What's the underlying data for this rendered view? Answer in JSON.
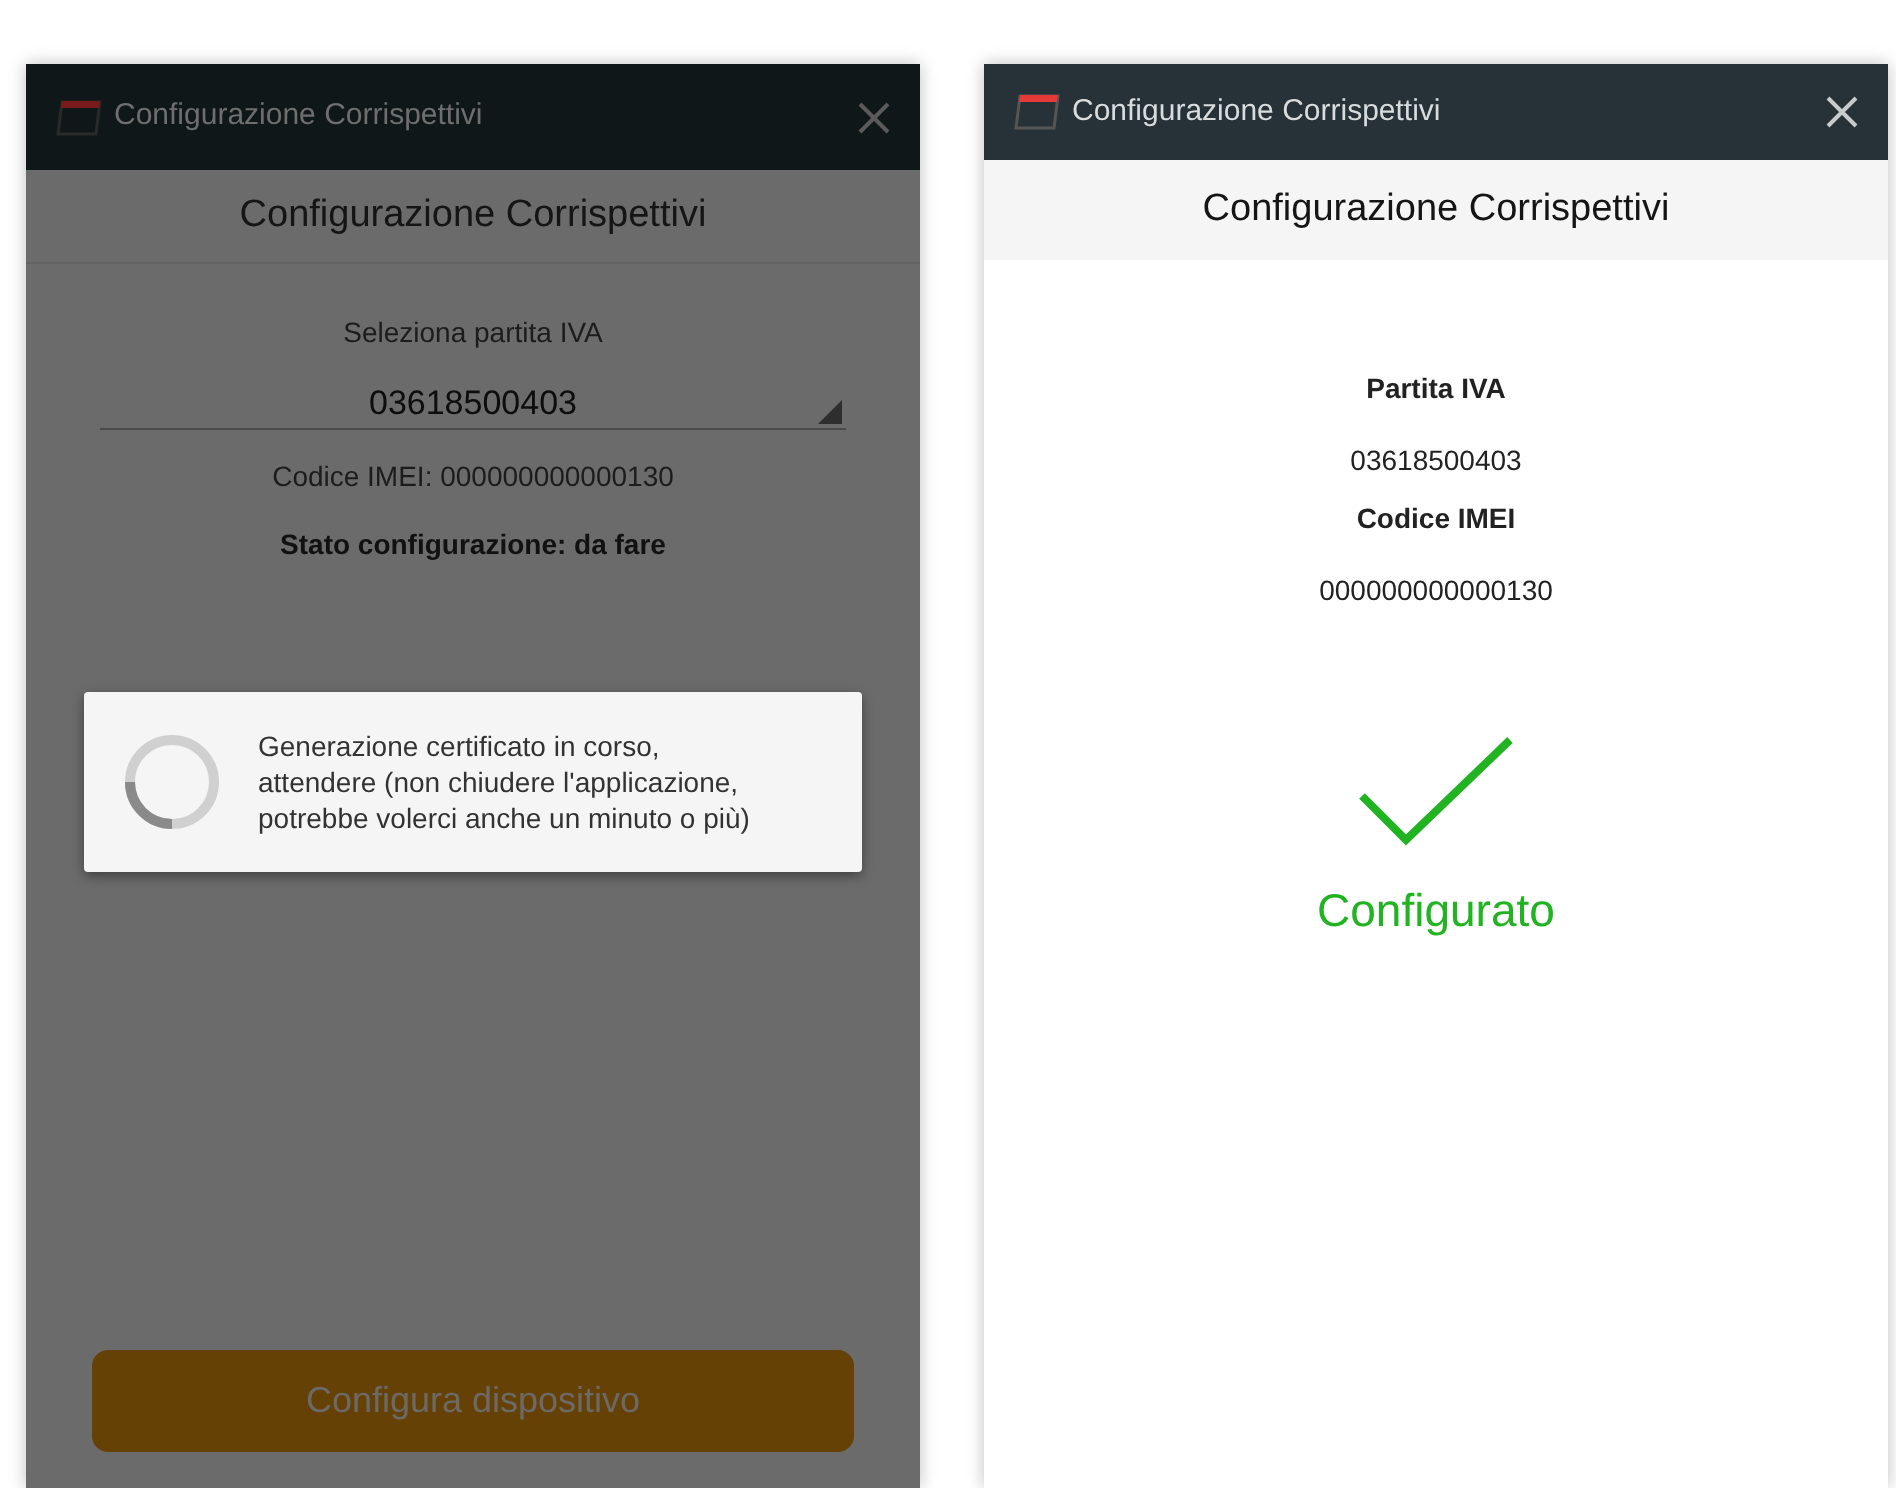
{
  "setup_screen": {
    "window_title": "Configurazione Corrispettivi",
    "header": "Configurazione Corrispettivi",
    "select_label": "Seleziona partita IVA",
    "selected_vat": "03618500403",
    "imei_line": "Codice IMEI: 000000000000130",
    "status_line": "Stato configurazione: da fare",
    "loading_dialog": {
      "message": "Generazione certificato in corso, attendere (non chiudere l'applicazione, potrebbe volerci anche un minuto o più)"
    },
    "button": {
      "label": "Configura dispositivo",
      "disabled": true
    }
  },
  "done_screen": {
    "window_title": "Configurazione Corrispettivi",
    "header": "Configurazione Corrispettivi",
    "fields": [
      {
        "label": "Partita IVA",
        "value": "03618500403"
      },
      {
        "label": "Codice IMEI",
        "value": "000000000000130"
      }
    ],
    "status": "Configurato"
  }
}
